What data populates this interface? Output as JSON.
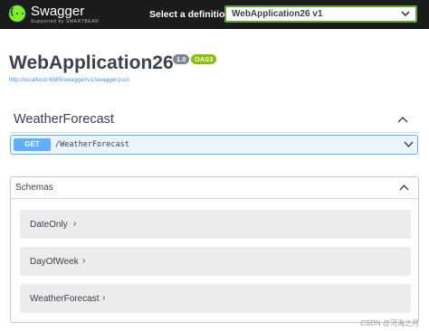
{
  "header": {
    "logo_glyph": "{...}",
    "app_name": "Swagger",
    "app_subtitle": "Supported by SMARTBEAR",
    "definition_label": "Select a definition",
    "definition_value": "WebApplication26 v1"
  },
  "info": {
    "title": "WebApplication26",
    "version": "1.0",
    "oas_badge": "OAS3",
    "url": "http://localhost:6565/swagger/v1/swagger.json"
  },
  "tag": {
    "name": "WeatherForecast",
    "operation": {
      "method": "GET",
      "path": "/WeatherForecast"
    }
  },
  "schemas": {
    "title": "Schemas",
    "models": [
      {
        "name": "DateOnly",
        "arrow": "›"
      },
      {
        "name": "DayOfWeek",
        "arrow": "›"
      },
      {
        "name": "WeatherForecast",
        "arrow": "›"
      }
    ]
  },
  "watermark": "CSDN @河海之月",
  "colors": {
    "topbar": "#1b1b1b",
    "logo": "#85ea2d",
    "get_method": "#61affe",
    "oas_badge": "#89bf04",
    "version_badge": "#7d8492",
    "link": "#4990e2"
  }
}
